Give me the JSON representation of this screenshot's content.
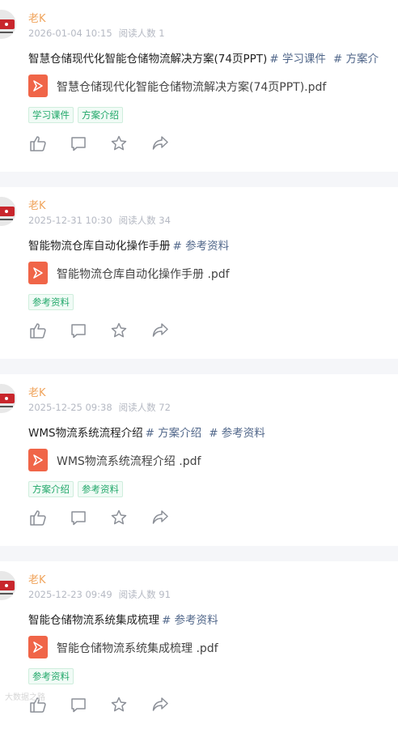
{
  "posts": [
    {
      "author": "老K",
      "date": "2026-01-04 10:15",
      "views": "阅读人数 1",
      "title": "智慧仓储现代化智能仓储物流解决方案(74页PPT)",
      "hashtags": [
        "# 学习课件",
        "# 方案介"
      ],
      "file_name": "智慧仓储现代化智能仓储物流解决方案(74页PPT).pdf",
      "chips": [
        "学习课件",
        "方案介绍"
      ]
    },
    {
      "author": "老K",
      "date": "2025-12-31 10:30",
      "views": "阅读人数 34",
      "title": "智能物流仓库自动化操作手册",
      "hashtags": [
        "# 参考资料"
      ],
      "file_name": "智能物流仓库自动化操作手册 .pdf",
      "chips": [
        "参考资料"
      ]
    },
    {
      "author": "老K",
      "date": "2025-12-25 09:38",
      "views": "阅读人数 72",
      "title": "WMS物流系统流程介绍",
      "hashtags": [
        "# 方案介绍",
        "# 参考资料"
      ],
      "file_name": "WMS物流系统流程介绍 .pdf",
      "chips": [
        "方案介绍",
        "参考资料"
      ]
    },
    {
      "author": "老K",
      "date": "2025-12-23 09:49",
      "views": "阅读人数 91",
      "title": "智能仓储物流系统集成梳理",
      "hashtags": [
        "# 参考资料"
      ],
      "file_name": "智能仓储物流系统集成梳理 .pdf",
      "chips": [
        "参考资料"
      ]
    }
  ],
  "watermark": "大数据之路",
  "icons": [
    "like-icon",
    "comment-icon",
    "favorite-icon",
    "share-icon",
    "pdf-file-icon"
  ],
  "colors": {
    "author": "#f0a35a",
    "hashtag": "#51678a",
    "chip_text": "#22a86a",
    "pdf_icon": "#f06548",
    "meta": "#b5b9c3"
  }
}
